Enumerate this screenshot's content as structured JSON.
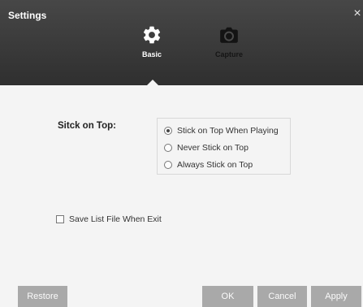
{
  "window": {
    "title": "Settings",
    "close_glyph": "×"
  },
  "tabs": [
    {
      "label": "Basic",
      "icon": "gear-icon",
      "active": true
    },
    {
      "label": "Capture",
      "icon": "camera-icon",
      "active": false
    }
  ],
  "stick_on_top": {
    "label": "Sitck on Top:",
    "options": [
      {
        "label": "Stick on Top When Playing",
        "checked": true
      },
      {
        "label": "Never Stick on Top",
        "checked": false
      },
      {
        "label": "Always Stick on Top",
        "checked": false
      }
    ]
  },
  "save_list": {
    "label": "Save List File When Exit",
    "checked": false
  },
  "buttons": {
    "restore": "Restore",
    "ok": "OK",
    "cancel": "Cancel",
    "apply": "Apply"
  },
  "colors": {
    "header_bg": "#3a3a3a",
    "body_bg": "#f4f4f4",
    "button_bg": "#a9a9a9",
    "active_tab_text": "#ffffff",
    "inactive_tab_text": "#151515"
  }
}
